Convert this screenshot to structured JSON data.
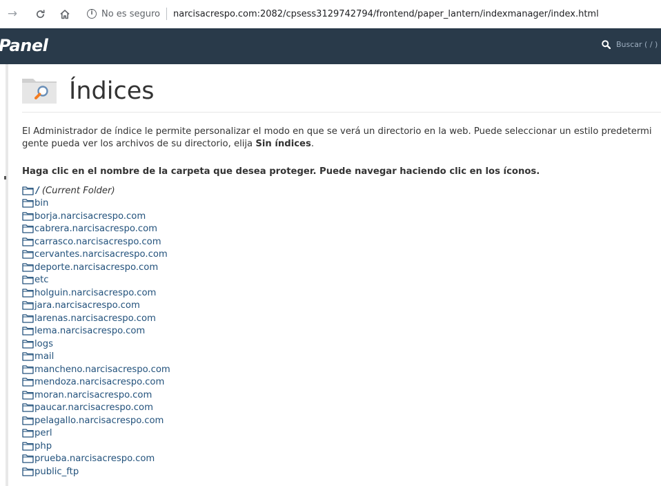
{
  "browser": {
    "security_label": "No es seguro",
    "url": "narcisacrespo.com:2082/cpsess3129742794/frontend/paper_lantern/indexmanager/index.html"
  },
  "header": {
    "logo_text": "Panel",
    "search_placeholder": "Buscar ( / )"
  },
  "page": {
    "title": "Índices",
    "description_line1": "El Administrador de índice le permite personalizar el modo en que se verá un directorio en la web. Puede seleccionar un estilo predetermi",
    "description_line2_pre": "gente pueda ver los archivos de su directorio, elija ",
    "description_line2_bold": "Sin índices",
    "description_line2_post": ".",
    "instruction": "Haga clic en el nombre de la carpeta que desea proteger. Puede navegar haciendo clic en los íconos."
  },
  "current_folder": {
    "slash": "/",
    "label": "(Current Folder)"
  },
  "folders": [
    "bin",
    "borja.narcisacrespo.com",
    "cabrera.narcisacrespo.com",
    "carrasco.narcisacrespo.com",
    "cervantes.narcisacrespo.com",
    "deporte.narcisacrespo.com",
    "etc",
    "holguin.narcisacrespo.com",
    "jara.narcisacrespo.com",
    "larenas.narcisacrespo.com",
    "lema.narcisacrespo.com",
    "logs",
    "mail",
    "mancheno.narcisacrespo.com",
    "mendoza.narcisacrespo.com",
    "moran.narcisacrespo.com",
    "paucar.narcisacrespo.com",
    "pelagallo.narcisacrespo.com",
    "perl",
    "php",
    "prueba.narcisacrespo.com",
    "public_ftp"
  ],
  "colors": {
    "header_bg": "#293a4a",
    "link": "#23527c"
  }
}
